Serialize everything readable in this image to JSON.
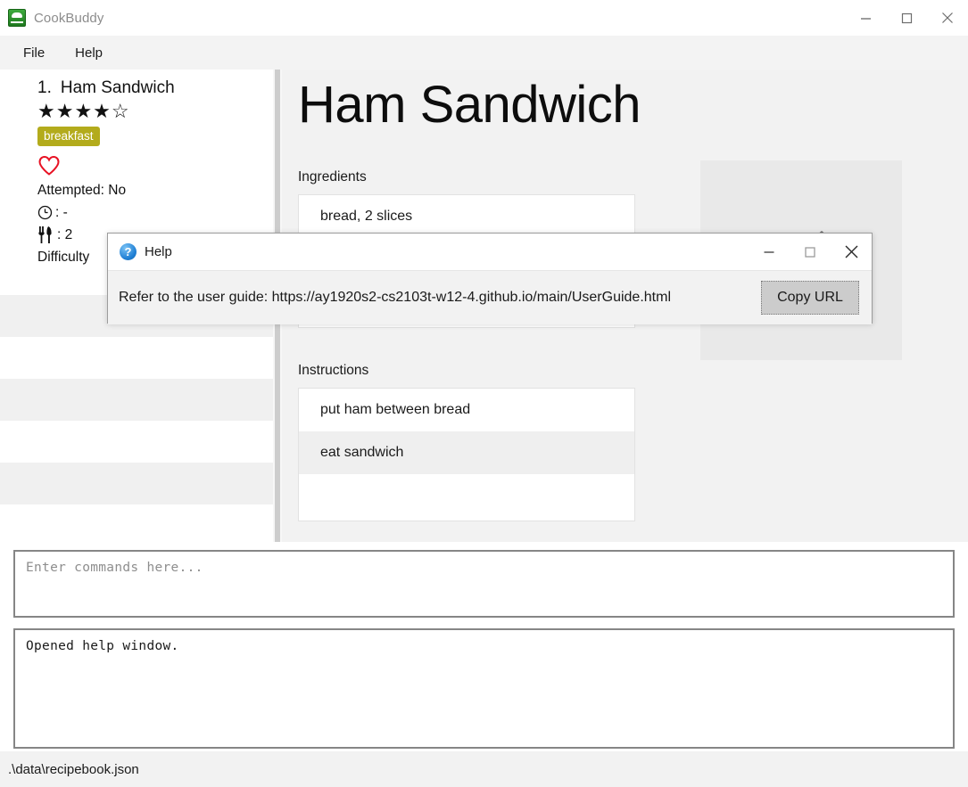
{
  "window": {
    "title": "CookBuddy",
    "app_icon": "recipe-book-icon",
    "controls": {
      "minimize": "minimize-icon",
      "maximize": "maximize-icon",
      "close": "close-icon"
    }
  },
  "menubar": {
    "items": [
      {
        "label": "File"
      },
      {
        "label": "Help"
      }
    ]
  },
  "sidebar": {
    "recipe_card": {
      "index": "1.",
      "name": "Ham Sandwich",
      "stars": "★★★★☆",
      "rating_value": 4,
      "rating_max": 5,
      "tag": "breakfast",
      "tag_color": "#b3ab1c",
      "favourite_icon": "heart-icon",
      "favourite_color": "#e81123",
      "attempted": "Attempted: No",
      "time_icon": "clock-icon",
      "time_value": ": -",
      "portion_icon": "cutlery-icon",
      "portion_value": ": 2",
      "difficulty_label": "Difficulty"
    },
    "empty_rows": 6
  },
  "detail": {
    "title": "Ham Sandwich",
    "ingredients_label": "Ingredients",
    "ingredients": [
      "bread, 2 slices"
    ],
    "instructions_label": "Instructions",
    "instructions": [
      "put ham between bread",
      "eat sandwich"
    ],
    "image_placeholder_icon": "cutlery-icon"
  },
  "command_box": {
    "placeholder": "Enter commands here...",
    "value": ""
  },
  "result_box": {
    "text": "Opened help window."
  },
  "statusbar": {
    "file_path": ".\\data\\recipebook.json"
  },
  "help_dialog": {
    "icon": "question-mark-icon",
    "title": "Help",
    "message": "Refer to the user guide: https://ay1920s2-cs2103t-w12-4.github.io/main/UserGuide.html",
    "copy_button": "Copy URL",
    "controls": {
      "minimize": "minimize-icon",
      "maximize": "maximize-icon",
      "close": "close-icon"
    }
  }
}
